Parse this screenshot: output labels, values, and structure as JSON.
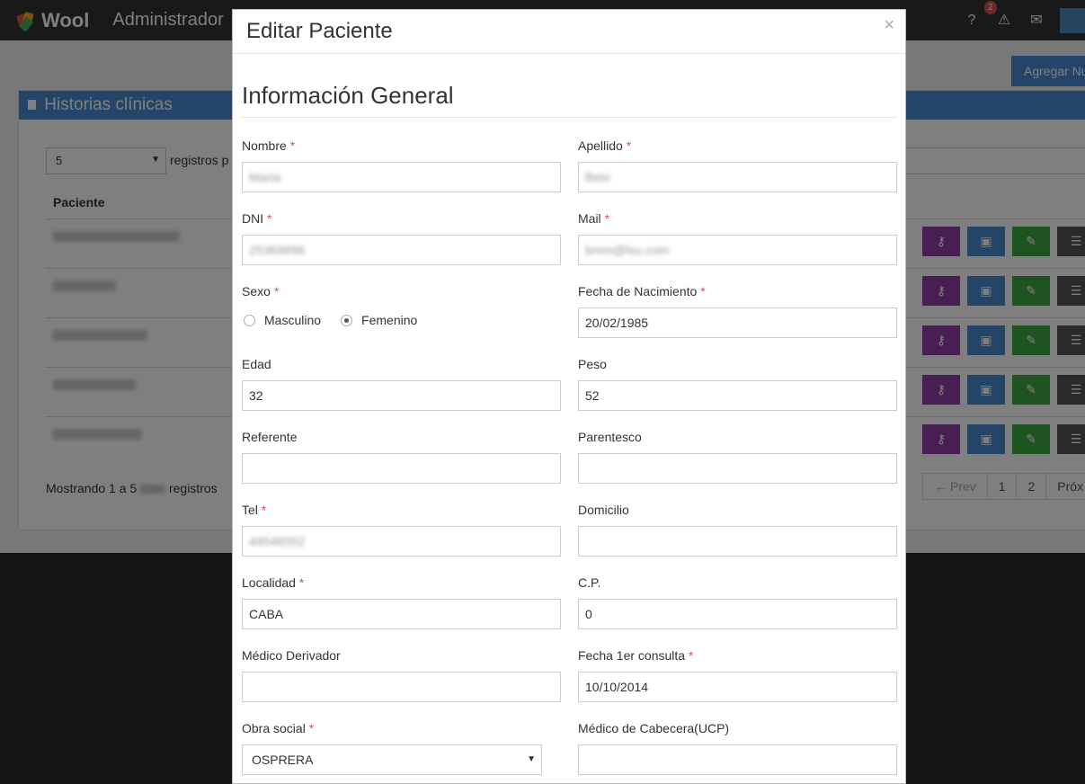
{
  "app": {
    "brand": "Wool",
    "title": "Administrador",
    "notifications_count": "2",
    "icons": [
      "help-icon",
      "alert-icon",
      "mail-icon"
    ]
  },
  "background": {
    "add_button_label": "Agregar Nu",
    "panel_title": "Historias clínicas",
    "per_page_value": "5",
    "per_page_suffix": "registros p",
    "column_header": "Paciente",
    "showing_prefix": "Mostrando 1 a 5",
    "showing_suffix": "registros",
    "pager": {
      "prev": "← Prev",
      "pages": [
        "1",
        "2"
      ],
      "next": "Próx →"
    },
    "row_count": 5,
    "action_icons": [
      "key-icon",
      "image-icon",
      "edit-icon",
      "menu-icon"
    ]
  },
  "modal": {
    "title": "Editar Paciente",
    "close": "×",
    "section_title": "Información General",
    "fields": {
      "nombre": {
        "label": "Nombre",
        "required": "*",
        "value": "Maria"
      },
      "apellido": {
        "label": "Apellido",
        "required": "*",
        "value": "Belo"
      },
      "dni": {
        "label": "DNI",
        "required": "*",
        "value": "25369896"
      },
      "mail": {
        "label": "Mail",
        "required": "*",
        "value": "bmm@lsu.com"
      },
      "sexo": {
        "label": "Sexo",
        "required": "*",
        "options": [
          "Masculino",
          "Femenino"
        ],
        "selected": "Femenino"
      },
      "fecha_nac": {
        "label": "Fecha de Nacimiento",
        "required": "*",
        "value": "20/02/1985"
      },
      "edad": {
        "label": "Edad",
        "value": "32"
      },
      "peso": {
        "label": "Peso",
        "value": "52"
      },
      "referente": {
        "label": "Referente",
        "value": ""
      },
      "parentesco": {
        "label": "Parentesco",
        "value": ""
      },
      "tel": {
        "label": "Tel",
        "required": "*",
        "value": "49546552"
      },
      "domicilio": {
        "label": "Domicilio",
        "value": ""
      },
      "localidad": {
        "label": "Localidad",
        "required": "*",
        "value": "CABA"
      },
      "cp": {
        "label": "C.P.",
        "value": "0"
      },
      "medico_derivador": {
        "label": "Médico Derivador",
        "value": ""
      },
      "fecha_1er": {
        "label": "Fecha 1er consulta",
        "required": "*",
        "value": "10/10/2014"
      },
      "obra_social": {
        "label": "Obra social",
        "required": "*",
        "value": "OSPRERA"
      },
      "medico_cabecera": {
        "label": "Médico de Cabecera(UCP)",
        "value": ""
      }
    }
  },
  "colors": {
    "accent": "#4a8bd1",
    "required": "#d9534f",
    "purple": "#8e3fa7",
    "green": "#3fa745"
  }
}
